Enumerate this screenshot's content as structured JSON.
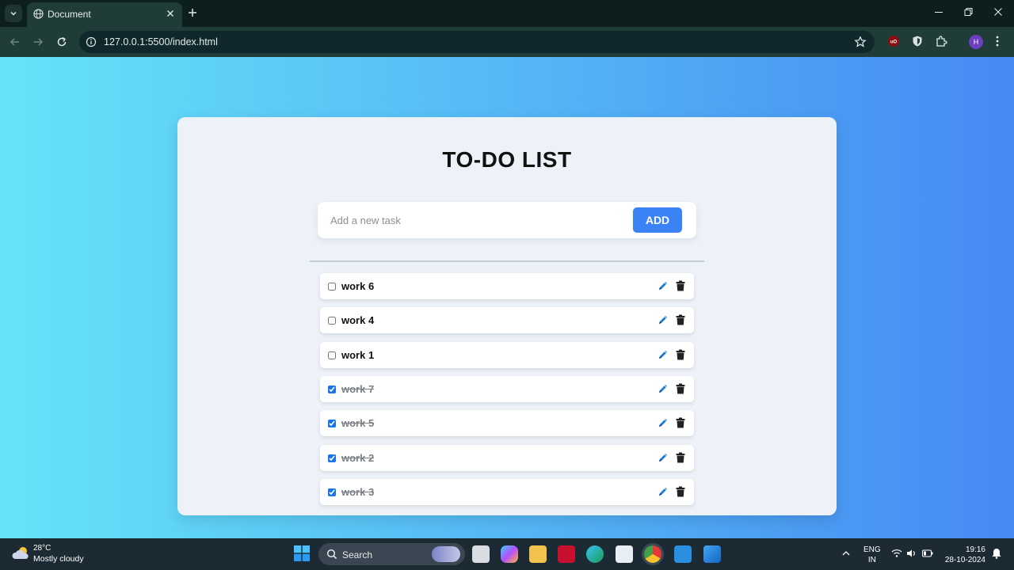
{
  "browser": {
    "tab_title": "Document",
    "url": "127.0.0.1:5500/index.html",
    "profile_initial": "H"
  },
  "app": {
    "title": "TO-DO LIST",
    "input_placeholder": "Add a new task",
    "add_label": "ADD",
    "accent_color": "#3b82f6"
  },
  "tasks": [
    {
      "text": "work 6",
      "done": false
    },
    {
      "text": "work 4",
      "done": false
    },
    {
      "text": "work 1",
      "done": false
    },
    {
      "text": "work 7",
      "done": true
    },
    {
      "text": "work 5",
      "done": true
    },
    {
      "text": "work 2",
      "done": true
    },
    {
      "text": "work 3",
      "done": true
    }
  ],
  "taskbar": {
    "weather_temp": "28°C",
    "weather_desc": "Mostly cloudy",
    "search_label": "Search",
    "lang_line1": "ENG",
    "lang_line2": "IN",
    "time": "19:16",
    "date": "28-10-2024"
  }
}
